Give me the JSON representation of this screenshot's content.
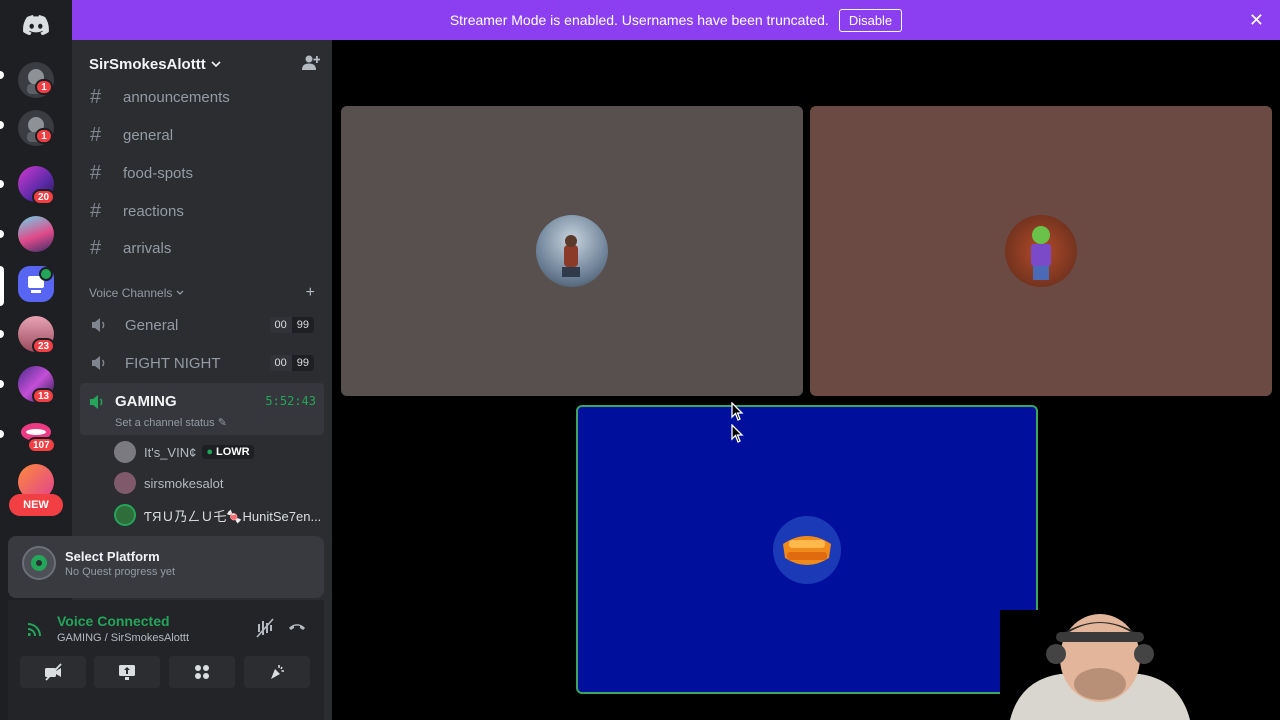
{
  "banner": {
    "message": "Streamer Mode is enabled. Usernames have been truncated.",
    "button_label": "Disable",
    "close_label": "✕"
  },
  "rail": {
    "badges": [
      "1",
      "1",
      "20",
      "23",
      "13",
      "107"
    ],
    "new_label": "NEW"
  },
  "server": {
    "name": "SirSmokesAlottt",
    "chevron": "⌄"
  },
  "text_channels": [
    "announcements",
    "general",
    "food-spots",
    "reactions",
    "arrivals"
  ],
  "voice_category": "Voice Channels",
  "voice_channels": [
    {
      "name": "General",
      "count_left": "00",
      "count_right": "99"
    },
    {
      "name": "FIGHT NIGHT",
      "count_left": "00",
      "count_right": "99"
    }
  ],
  "active_voice": {
    "name": "GAMING",
    "timer": "5:52:43",
    "status": "Set a channel status"
  },
  "members": [
    {
      "name": "It's_VIN¢",
      "tag": "LOWR"
    },
    {
      "name": "sirsmokesalot",
      "tag": ""
    },
    {
      "name": "ƬЯＵ乃ㄥＵ乇🍬HunitSe7en...",
      "tag": ""
    }
  ],
  "quest": {
    "title": "Select Platform",
    "subtitle": "No Quest progress yet"
  },
  "voice_connected": {
    "title": "Voice Connected",
    "subtitle": "GAMING / SirSmokesAlottt"
  },
  "icons": {
    "home": "discord-icon",
    "invite": "add-member-icon",
    "signal": "signal-icon",
    "noise": "noise-suppression-icon",
    "hangup": "disconnect-icon"
  },
  "colors": {
    "banner": "#8b3ff0",
    "active_green": "#23a55a",
    "tile1": "#57504f",
    "tile2": "#6a4a43",
    "tile3": "#000f9c"
  }
}
